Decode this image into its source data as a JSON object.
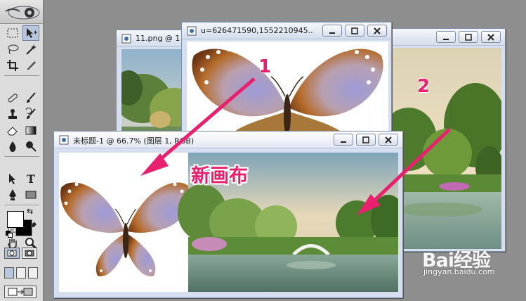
{
  "windows": {
    "back_left": {
      "title": "11.png @ 1"
    },
    "back_center": {
      "title": "u=626471590,1552210945..."
    },
    "front": {
      "title": "未标题-1 @ 66.7% (图层 1, RGB)"
    }
  },
  "annotations": {
    "label_1": "1",
    "label_2": "2",
    "new_canvas": "新画布"
  },
  "watermark": {
    "brand": "Bai经验",
    "url": "jingyan.baidu.com"
  },
  "toolbox": {
    "tools": [
      "marquee",
      "move",
      "lasso",
      "magic-wand",
      "crop",
      "slice",
      "healing-brush",
      "brush",
      "clone-stamp",
      "history-brush",
      "eraser",
      "gradient",
      "blur",
      "dodge",
      "path-select",
      "type",
      "pen",
      "shape",
      "notes",
      "eyedropper",
      "hand",
      "zoom"
    ],
    "foreground_color": "#ffffff",
    "background_color": "#000000"
  },
  "colors": {
    "accent": "#e8206e",
    "window_frame": "#d6dfef"
  }
}
